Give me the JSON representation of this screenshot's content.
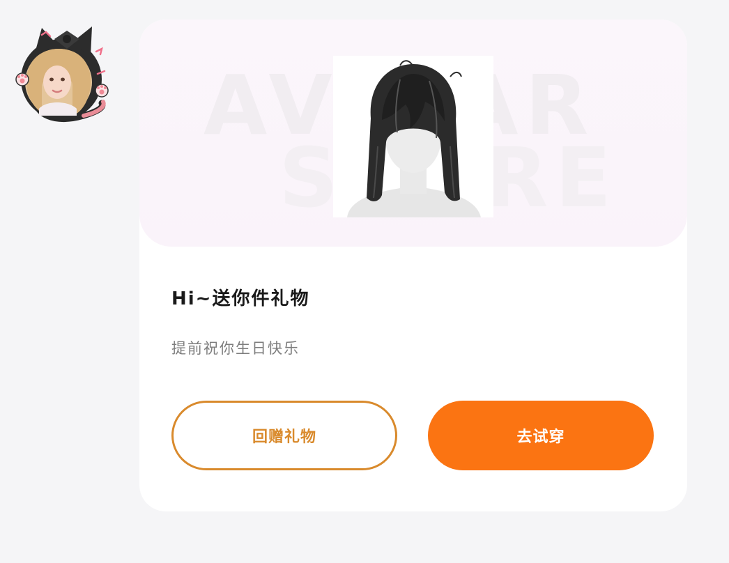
{
  "sender": {
    "avatar_icon": "cat-ear-avatar-icon"
  },
  "gift_card": {
    "banner_text_line1": "AVATAR",
    "banner_text_line2": "STORE",
    "product_icon": "long-black-hair-icon",
    "title": "Hi~送你件礼物",
    "subtitle": "提前祝你生日快乐",
    "return_gift_label": "回赠礼物",
    "try_on_label": "去试穿"
  },
  "colors": {
    "accent_orange": "#fb7412",
    "outline_orange": "#d98a2c",
    "card_bg": "#ffffff",
    "page_bg": "#f5f5f7"
  }
}
